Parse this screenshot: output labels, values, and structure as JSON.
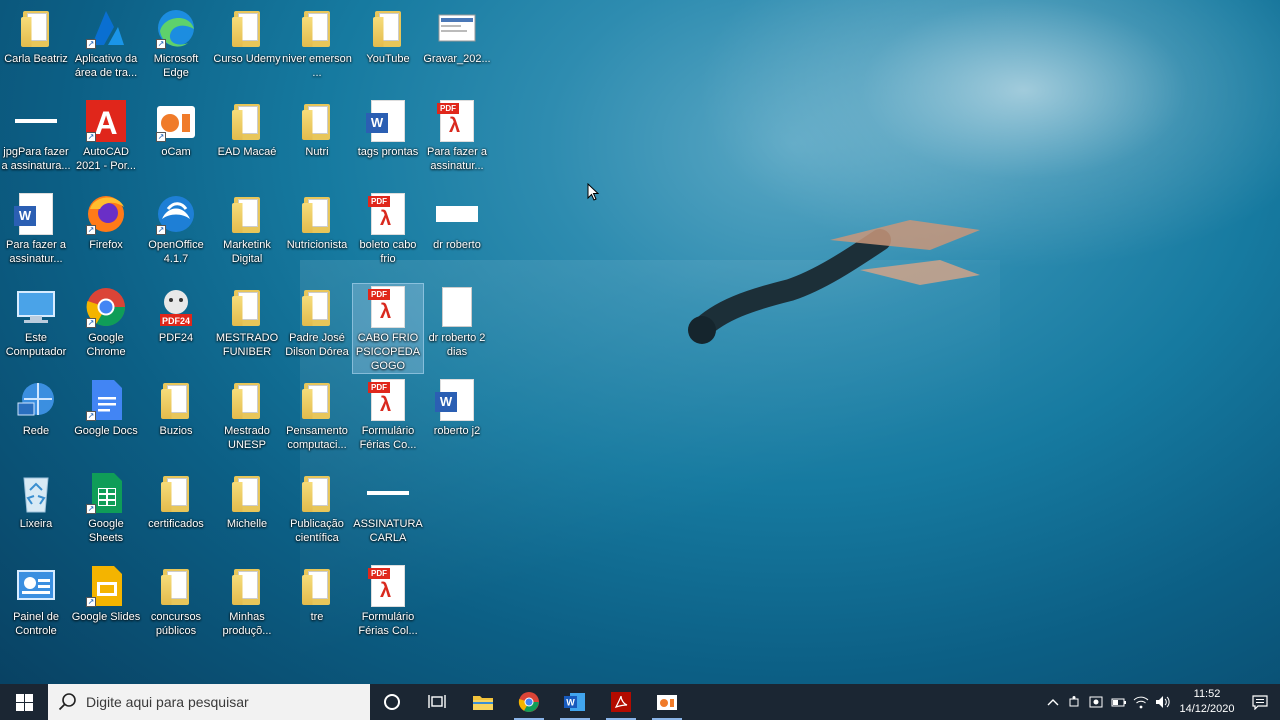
{
  "desktop": {
    "icons": [
      {
        "label": "Carla Beatriz",
        "kind": "folder",
        "col": 0,
        "row": 0
      },
      {
        "label": "Aplicativo da área de tra...",
        "kind": "azure",
        "col": 1,
        "row": 0
      },
      {
        "label": "Microsoft Edge",
        "kind": "edge",
        "col": 2,
        "row": 0
      },
      {
        "label": "Curso Udemy",
        "kind": "folder",
        "col": 3,
        "row": 0
      },
      {
        "label": "niver emerson ...",
        "kind": "folder",
        "col": 4,
        "row": 0
      },
      {
        "label": "YouTube",
        "kind": "folder",
        "col": 5,
        "row": 0
      },
      {
        "label": "Gravar_202...",
        "kind": "screenshot",
        "col": 6,
        "row": 0
      },
      {
        "label": "jpgPara fazer a assinatura...",
        "kind": "bar",
        "col": 0,
        "row": 1
      },
      {
        "label": "AutoCAD 2021 - Por...",
        "kind": "autocad",
        "col": 1,
        "row": 1
      },
      {
        "label": "oCam",
        "kind": "ocam",
        "col": 2,
        "row": 1
      },
      {
        "label": "EAD Macaé",
        "kind": "folder",
        "col": 3,
        "row": 1
      },
      {
        "label": "Nutri",
        "kind": "folder",
        "col": 4,
        "row": 1
      },
      {
        "label": "tags prontas",
        "kind": "word",
        "col": 5,
        "row": 1
      },
      {
        "label": "Para fazer a assinatur...",
        "kind": "pdf",
        "col": 6,
        "row": 1
      },
      {
        "label": "Para fazer a assinatur...",
        "kind": "word",
        "col": 0,
        "row": 2
      },
      {
        "label": "Firefox",
        "kind": "firefox",
        "col": 1,
        "row": 2
      },
      {
        "label": "OpenOffice 4.1.7",
        "kind": "openoffice",
        "col": 2,
        "row": 2
      },
      {
        "label": "Marketink Digital",
        "kind": "folder",
        "col": 3,
        "row": 2
      },
      {
        "label": "Nutricionista",
        "kind": "folder",
        "col": 4,
        "row": 2
      },
      {
        "label": "boleto cabo frio",
        "kind": "pdf",
        "col": 5,
        "row": 2
      },
      {
        "label": "dr roberto",
        "kind": "widewhite",
        "col": 6,
        "row": 2
      },
      {
        "label": "Este Computador",
        "kind": "computer",
        "col": 0,
        "row": 3
      },
      {
        "label": "Google Chrome",
        "kind": "chrome",
        "col": 1,
        "row": 3
      },
      {
        "label": "PDF24",
        "kind": "pdf24",
        "col": 2,
        "row": 3
      },
      {
        "label": "MESTRADO FUNIBER",
        "kind": "folder",
        "col": 3,
        "row": 3
      },
      {
        "label": "Padre José Dilson Dórea",
        "kind": "folder",
        "col": 4,
        "row": 3
      },
      {
        "label": "CABO FRIO PSICOPEDAGOGO",
        "kind": "pdf",
        "col": 5,
        "row": 3,
        "selected": true
      },
      {
        "label": "dr roberto 2 dias",
        "kind": "blank",
        "col": 6,
        "row": 3
      },
      {
        "label": "Rede",
        "kind": "network",
        "col": 0,
        "row": 4
      },
      {
        "label": "Google Docs",
        "kind": "gdocs",
        "col": 1,
        "row": 4
      },
      {
        "label": "Buzios",
        "kind": "folder",
        "col": 2,
        "row": 4
      },
      {
        "label": "Mestrado UNESP",
        "kind": "folder",
        "col": 3,
        "row": 4
      },
      {
        "label": "Pensamento computaci...",
        "kind": "folder",
        "col": 4,
        "row": 4
      },
      {
        "label": "Formulário Férias Co...",
        "kind": "pdf",
        "col": 5,
        "row": 4
      },
      {
        "label": "roberto j2",
        "kind": "word",
        "col": 6,
        "row": 4
      },
      {
        "label": "Lixeira",
        "kind": "recycle",
        "col": 0,
        "row": 5
      },
      {
        "label": "Google Sheets",
        "kind": "gsheets",
        "col": 1,
        "row": 5
      },
      {
        "label": "certificados",
        "kind": "folder",
        "col": 2,
        "row": 5
      },
      {
        "label": "Michelle",
        "kind": "folder",
        "col": 3,
        "row": 5
      },
      {
        "label": "Publicação científica",
        "kind": "folder",
        "col": 4,
        "row": 5
      },
      {
        "label": "ASSINATURA CARLA",
        "kind": "bar",
        "col": 5,
        "row": 5
      },
      {
        "label": "Painel de Controle",
        "kind": "controlpanel",
        "col": 0,
        "row": 6
      },
      {
        "label": "Google Slides",
        "kind": "gslides",
        "col": 1,
        "row": 6
      },
      {
        "label": "concursos públicos",
        "kind": "folder",
        "col": 2,
        "row": 6
      },
      {
        "label": "Minhas produçõ...",
        "kind": "folder",
        "col": 3,
        "row": 6
      },
      {
        "label": "tre",
        "kind": "folder",
        "col": 4,
        "row": 6
      },
      {
        "label": "Formulário Férias Col...",
        "kind": "pdf",
        "col": 5,
        "row": 6
      }
    ]
  },
  "taskbar": {
    "search_placeholder": "Digite aqui para pesquisar",
    "pinned": [
      "task-view",
      "file-explorer",
      "chrome",
      "word",
      "acrobat",
      "ocam"
    ],
    "clock_time": "11:52",
    "clock_date": "14/12/2020"
  }
}
